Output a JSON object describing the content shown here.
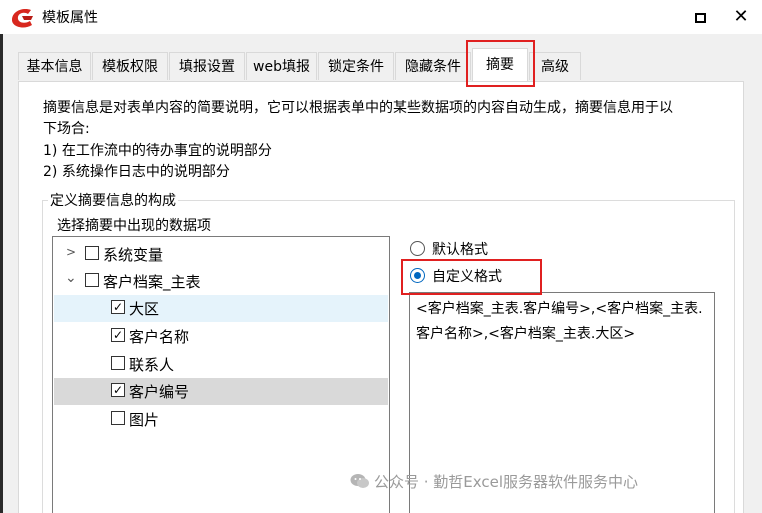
{
  "window": {
    "title": "模板属性",
    "maximize_icon": "maximize-icon",
    "close_label": "✕"
  },
  "tabs": [
    {
      "label": "基本信息",
      "active": false
    },
    {
      "label": "模板权限",
      "active": false
    },
    {
      "label": "填报设置",
      "active": false
    },
    {
      "label": "web填报",
      "active": false
    },
    {
      "label": "锁定条件",
      "active": false
    },
    {
      "label": "隐藏条件",
      "active": false
    },
    {
      "label": "摘要",
      "active": true
    },
    {
      "label": "高级",
      "active": false
    }
  ],
  "description": {
    "line1": "摘要信息是对表单内容的简要说明，它可以根据表单中的某些数据项的内容自动生成，摘要信息用于以",
    "line2": "下场合:",
    "line3": "1) 在工作流中的待办事宜的说明部分",
    "line4": "2) 系统操作日志中的说明部分"
  },
  "group": {
    "title": "定义摘要信息的构成",
    "list_label": "选择摘要中出现的数据项",
    "tree": [
      {
        "label": "系统变量",
        "level": 0,
        "arrow": ">",
        "checked": false
      },
      {
        "label": "客户档案_主表",
        "level": 0,
        "arrow": "⌄",
        "checked": false
      },
      {
        "label": "大区",
        "level": 1,
        "checked": true,
        "highlight": "light"
      },
      {
        "label": "客户名称",
        "level": 1,
        "checked": true
      },
      {
        "label": "联系人",
        "level": 1,
        "checked": false
      },
      {
        "label": "客户编号",
        "level": 1,
        "checked": true,
        "highlight": "dark"
      },
      {
        "label": "图片",
        "level": 1,
        "checked": false
      }
    ],
    "format_options": [
      {
        "label": "默认格式",
        "selected": false
      },
      {
        "label": "自定义格式",
        "selected": true
      }
    ],
    "custom_format": "<客户档案_主表.客户编号>,<客户档案_主表.客户名称>,<客户档案_主表.大区>"
  },
  "watermark": "公众号 · 勤哲Excel服务器软件服务中心",
  "colors": {
    "highlight_red": "#e02020",
    "radio_blue": "#0067c0"
  }
}
